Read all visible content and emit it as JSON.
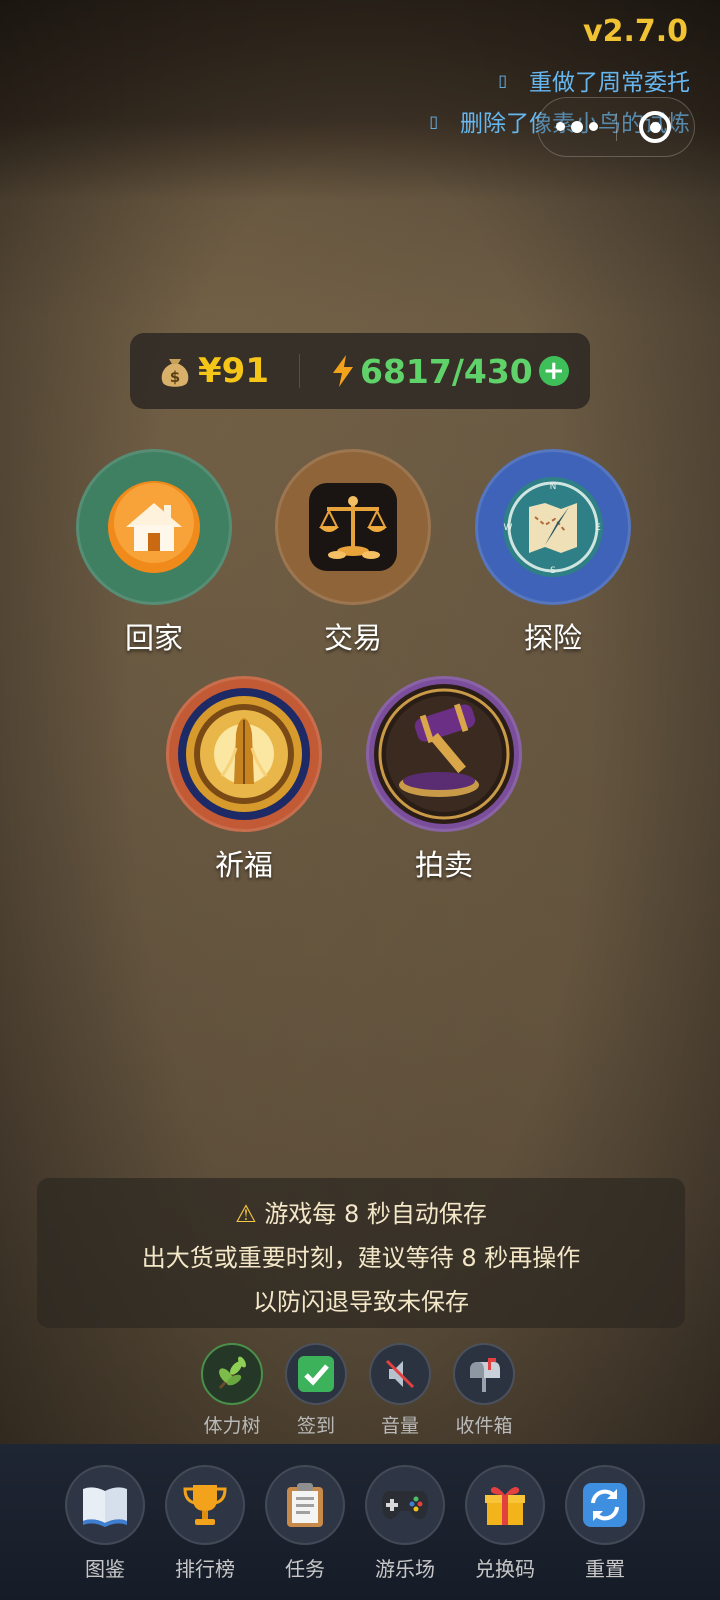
{
  "version": "v2.7.0",
  "changelog": [
    {
      "bullet": "▯",
      "text": "重做了周常委托"
    },
    {
      "bullet": "▯",
      "text": "删除了像素小鸟的试炼"
    }
  ],
  "resources": {
    "money": "¥91",
    "energy": "6817/430",
    "add_label": "+"
  },
  "main_buttons": [
    {
      "label": "回家",
      "color": "#3f7f62"
    },
    {
      "label": "交易",
      "color": "#8f6438"
    },
    {
      "label": "探险",
      "color": "#3f63b8"
    },
    {
      "label": "祈福",
      "color": "#c25a35"
    },
    {
      "label": "拍卖",
      "color": "#7a4e9a"
    }
  ],
  "notice": {
    "line1": "游戏每 8 秒自动保存",
    "line2": "出大货或重要时刻，建议等待 8 秒再操作",
    "line3": "以防闪退导致未保存"
  },
  "tools": [
    {
      "label": "体力树",
      "icon": "branch-icon"
    },
    {
      "label": "签到",
      "icon": "checkmark-icon"
    },
    {
      "label": "音量",
      "icon": "mute-icon"
    },
    {
      "label": "收件箱",
      "icon": "mailbox-icon"
    }
  ],
  "bottom_nav": [
    {
      "label": "图鉴",
      "icon": "book-icon"
    },
    {
      "label": "排行榜",
      "icon": "trophy-icon"
    },
    {
      "label": "任务",
      "icon": "clipboard-icon"
    },
    {
      "label": "游乐场",
      "icon": "gamepad-icon"
    },
    {
      "label": "兑换码",
      "icon": "gift-icon"
    },
    {
      "label": "重置",
      "icon": "refresh-icon"
    }
  ]
}
